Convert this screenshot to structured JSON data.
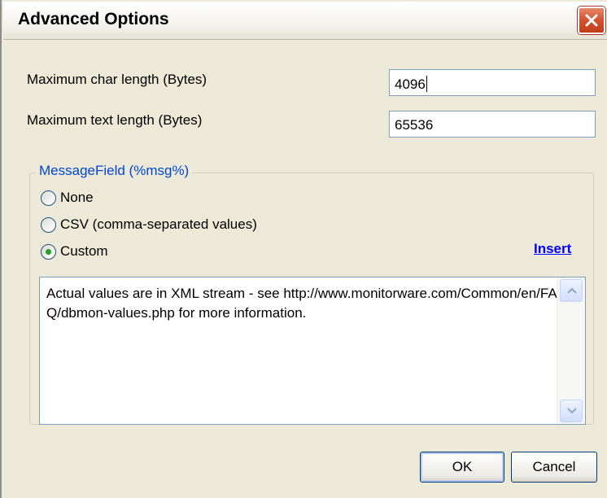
{
  "window": {
    "title": "Advanced Options",
    "close_icon": "close-icon"
  },
  "fields": {
    "char_length": {
      "label": "Maximum char length (Bytes)",
      "value": "4096"
    },
    "text_length": {
      "label": "Maximum text length (Bytes)",
      "value": "65536"
    }
  },
  "message_field": {
    "legend": "MessageField (%msg%)",
    "options": [
      {
        "label": "None",
        "selected": false
      },
      {
        "label": "CSV (comma-separated values)",
        "selected": false
      },
      {
        "label": "Custom",
        "selected": true
      }
    ],
    "insert_label": "Insert",
    "custom_text": "Actual values are in XML stream - see http://www.monitorware.com/Common/en/FAQ/dbmon-values.php for more information."
  },
  "buttons": {
    "ok": "OK",
    "cancel": "Cancel"
  },
  "colors": {
    "accent": "#0046d5",
    "link": "#0000ff",
    "close": "#d2522e",
    "dialog_bg": "#ece9d8"
  }
}
